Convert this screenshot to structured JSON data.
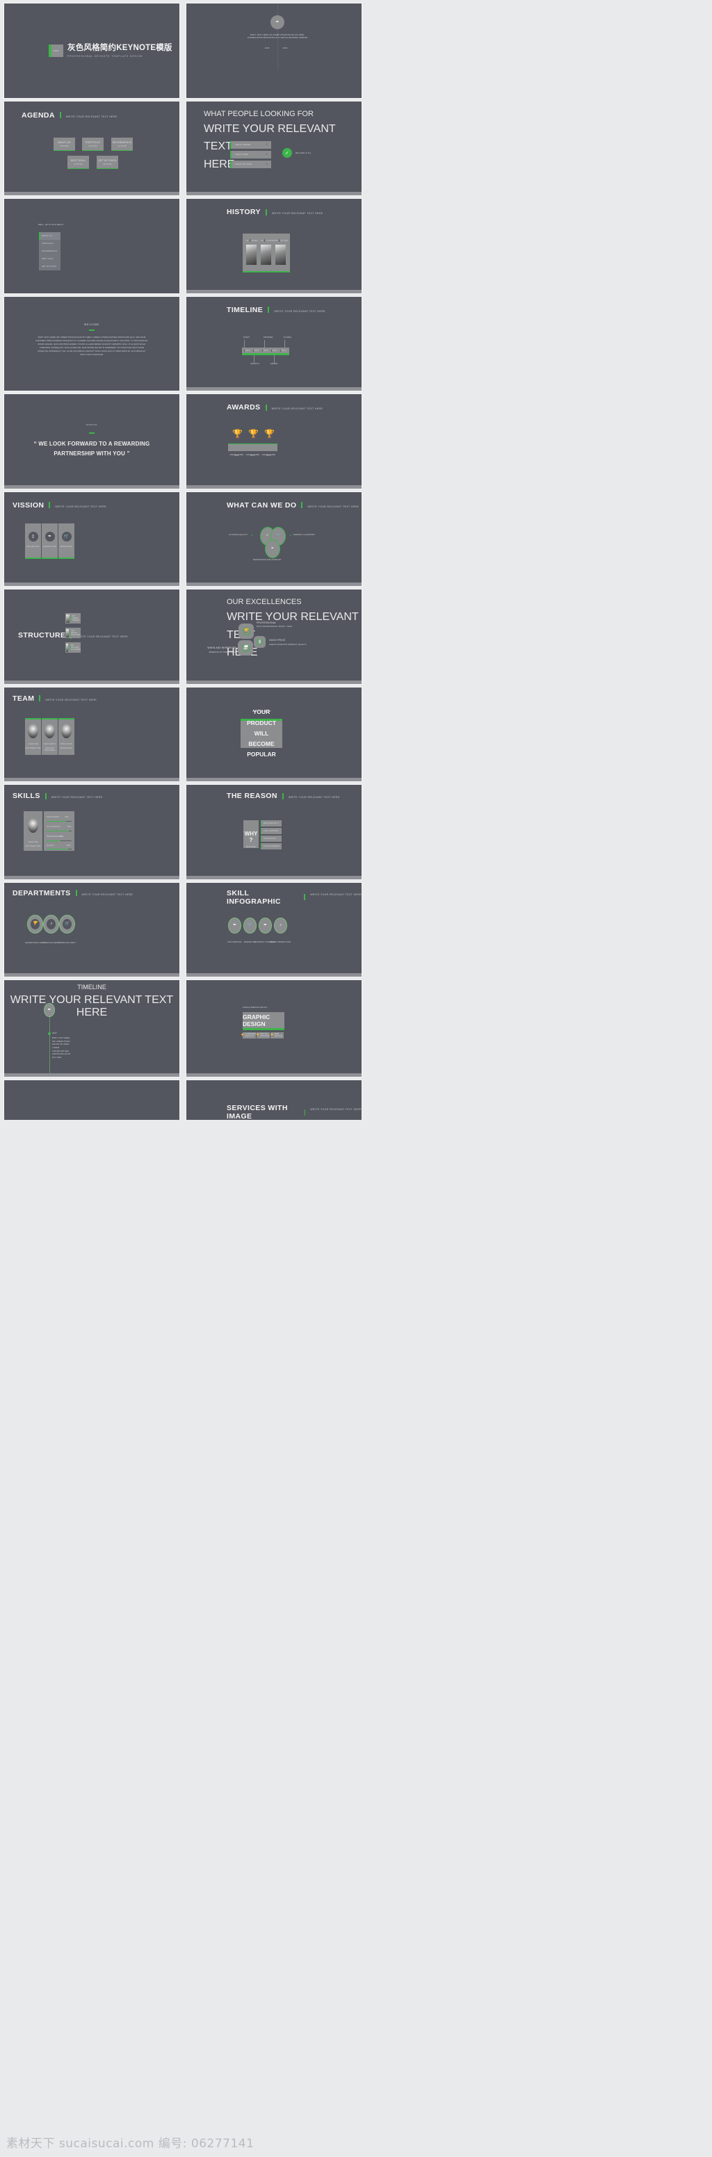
{
  "theme": {
    "bg": "#53565e",
    "accent": "#3cb54a",
    "panel": "#8b8d8f",
    "text": "#f1f2f3"
  },
  "watermark": "素材天下 sucaisucai.com 编号: 06277141",
  "common": {
    "subtitle": "WRITE YOUR RELEVANT TEXT HERE",
    "subtitle_l1": "WRITE YOUR RELEVANT TEXT",
    "subtitle_l2": "HERE"
  },
  "slides": [
    {
      "index": 1,
      "name": "cover",
      "logo_text": "LOGO",
      "title": "灰色风格简约KEYNOTE模版",
      "subtitle": "PROFESSIONAL KEYNOTE TEMPLATE DESIGN"
    },
    {
      "index": 2,
      "name": "intro",
      "icon": "feather-icon",
      "body": "BODY TEXT HERE OR LOREM IPSUM DOLOR SIT AMET CONSECTETUR ADIPISCING ELIT SED DO EIUSMOD TEMPOR",
      "label_left": "2015",
      "label_right": "2016"
    },
    {
      "index": 3,
      "name": "agenda",
      "title": "AGENDA",
      "subtitle": "WRITE YOUR RELEVANT TEXT HERE",
      "cards": [
        {
          "label": "ABOUT US",
          "time": "09:00 AM"
        },
        {
          "label": "PORTFOLIO",
          "time": "10:30 AM"
        },
        {
          "label": "INFOGRAPHICS",
          "time": "11:30 AM"
        },
        {
          "label": "NEXT GOAL",
          "time": "13:00 AM"
        },
        {
          "label": "GET IN TOUCH",
          "time": "14:00 AM"
        }
      ]
    },
    {
      "index": 4,
      "name": "what-people-looking-for",
      "title": "WHAT PEOPLE LOOKING FOR",
      "rows": [
        "GREAT THEMES",
        "GREAT NAME",
        "GREAT VISITORS"
      ],
      "badge_icon": "check-icon",
      "badge_label": "WE HAVE IT ALL"
    },
    {
      "index": 5,
      "name": "agenda-menu",
      "kicker": "WELL, LET'S TALK ABOUT",
      "items": [
        "ABOUT US",
        "PORTFOLIO",
        "INFOGRAPHICS",
        "NEXT GOAL",
        "GET IN TOUCH"
      ],
      "active": 0
    },
    {
      "index": 6,
      "name": "history",
      "title": "HISTORY",
      "subtitle": "WRITE YOUR RELEVANT TEXT HERE",
      "entries": [
        {
          "num": "01",
          "label": "START"
        },
        {
          "num": "02",
          "label": "CONCEPT"
        },
        {
          "num": "03",
          "label": "FLYING"
        }
      ]
    },
    {
      "index": 7,
      "name": "welcome",
      "kicker": "WELCOME",
      "body": "BODY TEXT HERE OR LOREM IPSUM DOLOR SIT AMET, LOREM CONSECTETUER ADIPISCING ELIT, SED DIAM NONUMMY NIBH EUISMOD TINCIDUNT UT LAOREET DOLORE MAGNA ALIQUAM ERAT VOLUTPAT. UT WISI ENIM AD MINIM VENIAM, QUIS NOSTRUD EXERCI TATION ULLAMCORPER SUSCIPIT LOBORTIS NISL UT ALIQUIP EX EA COMMODO CONSEQUAT. DUIS AUTEM VEL EUM IRIURE DOLOR IN HENDRERIT IN VULPUTATE VELIT ESSE MOLESTIE CONSEQUAT, VEL ILLUM DOLORE EU FEUGIAT NULLA FACILISIS AT VERO EROS ET ACCUMSAN ET IUSTO ODIO DIGNISSIM."
    },
    {
      "index": 8,
      "name": "timeline-horizontal",
      "title": "TIMELINE",
      "subtitle": "WRITE YOUR RELEVANT TEXT HERE",
      "top_labels": [
        "START",
        "PARTNER",
        "GLOBAL"
      ],
      "bottom_labels": [
        "GROWTH",
        "AWARD"
      ],
      "years": [
        "2010",
        "2011",
        "2012",
        "2013",
        "2014"
      ]
    },
    {
      "index": 9,
      "name": "mission-quote",
      "kicker": "MISSION",
      "quote_line1": "“ WE LOOK FORWARD TO A REWARDING",
      "quote_line2": "PARTNERSHIP WITH YOU ”"
    },
    {
      "index": 10,
      "name": "awards",
      "title": "AWARDS",
      "subtitle": "WRITE YOUR RELEVANT TEXT HERE",
      "items": [
        {
          "year": "2011",
          "label": "AWARD NAME"
        },
        {
          "year": "2012",
          "label": "AWARD NAME"
        },
        {
          "year": "2013",
          "label": "AWARD NAME"
        }
      ]
    },
    {
      "index": 11,
      "name": "vission",
      "title": "VISSION",
      "subtitle": "WRITE YOUR RELEVANT TEXT HERE",
      "cards": [
        {
          "label": "PROJECTING",
          "icon": "tablet-icon"
        },
        {
          "label": "PRODUCTION",
          "icon": "feather-icon"
        },
        {
          "label": "MARKETING",
          "icon": "cart-icon"
        }
      ]
    },
    {
      "index": 12,
      "name": "what-can-we-do",
      "title": "WHAT CAN WE DO",
      "subtitle": "WRITE YOUR RELEVANT TEXT HERE",
      "labels": [
        "ULTIMATE QUALITY",
        "PERFECT & SUPPORT",
        "RESPONSIVE AND SUPPORT"
      ],
      "icons": [
        "search-icon",
        "cart-icon",
        "feather-icon"
      ]
    },
    {
      "index": 13,
      "name": "structure",
      "title": "STRUCTURE",
      "subtitle": "WRITE YOUR RELEVANT TEXT HERE",
      "people": [
        {
          "name": "MR. JAMES",
          "role": "OWNER"
        },
        {
          "name": "MR. BRIAN",
          "role": "PARTNER"
        },
        {
          "name": "MR. SALAMA",
          "role": "FOUNDER"
        }
      ]
    },
    {
      "index": 14,
      "name": "our-excellences",
      "title": "OUR EXCELLENCES",
      "subtitle_l1": "WRITE YOUR RELEVANT TEXT",
      "subtitle_l2": "HERE",
      "items": [
        {
          "label": "PROFESSIONAL",
          "desc": "WITH PROFESSIONAL WORK / YEAR",
          "icon": "trophy-icon"
        },
        {
          "label": "GOOD PRICE",
          "desc": "CHEAP PRICE BUT PERFECT QUALITY",
          "icon": "dollar-icon"
        },
        {
          "label": "WHEN AND WHEREVER",
          "desc": "FREEDOM OF TIME / PLACE",
          "icon": "laptop-icon"
        }
      ]
    },
    {
      "index": 15,
      "name": "team",
      "title": "TEAM",
      "subtitle": "WRITE YOUR RELEVANT TEXT HERE",
      "members": [
        {
          "name": "JOHN DOE",
          "role": "ART DIRECTOR"
        },
        {
          "name": "SARA SMITH",
          "role": "GRAPHIC DESIGNER"
        },
        {
          "name": "SMILE RYAN",
          "role": "MARKETING"
        }
      ]
    },
    {
      "index": 16,
      "name": "product-result",
      "kicker": "WHAT THE RESULT",
      "line1": "YOUR PRODUCT WILL",
      "line2": "BECOME POPULAR"
    },
    {
      "index": 17,
      "name": "skills",
      "title": "SKILLS",
      "subtitle": "WRITE YOUR RELEVANT TEXT HERE",
      "person": {
        "name": "JOHN DOE",
        "role": "ART DIRECTOR"
      },
      "bars": [
        {
          "label": "PHOTOSHOP",
          "value": "78%",
          "pct": 78
        },
        {
          "label": "ILLUSTRATOR",
          "value": "90%",
          "pct": 90
        },
        {
          "label": "DREAMWEAVER",
          "value": "55%",
          "pct": 55
        },
        {
          "label": "3D MAX",
          "value": "85%",
          "pct": 85
        }
      ]
    },
    {
      "index": 18,
      "name": "the-reason",
      "title": "THE REASON",
      "subtitle": "WRITE YOUR RELEVANT TEXT HERE",
      "why": "WHY ?",
      "why_sub": "BECAUSE",
      "reasons": [
        "RESPONSIVE IT",
        "FULL SUPPORT",
        "GUARANTEE",
        "CLEAN MODERN"
      ]
    },
    {
      "index": 19,
      "name": "departments",
      "title": "DEPARTMENTS",
      "subtitle": "WRITE YOUR RELEVANT TEXT HERE",
      "items": [
        {
          "label": "ADVERTISING DEPT.",
          "icon": "trophy-icon"
        },
        {
          "label": "CREATIVE DEPT.",
          "icon": "search-icon"
        },
        {
          "label": "MARKETING DEPT.",
          "icon": "cart-icon"
        }
      ]
    },
    {
      "index": 20,
      "name": "skill-infographic",
      "title": "SKILL INFOGRAPHIC",
      "subtitle": "WRITE YOUR RELEVANT TEXT HERE",
      "items": [
        {
          "label": "COPYWRITING",
          "icon": "feather-icon"
        },
        {
          "label": "MARKETING",
          "icon": "cart-icon"
        },
        {
          "label": "CONTENT STRATEGY",
          "icon": "quill-icon"
        },
        {
          "label": "MUSIC PRODUCTION",
          "icon": "music-note-icon"
        }
      ]
    },
    {
      "index": 21,
      "name": "timeline-vertical",
      "title": "TIMELINE",
      "subtitle": "WRITE YOUR RELEVANT TEXT HERE",
      "icon": "feather-icon",
      "year": "2009",
      "body": "BODY TEXT HERE OR LOREM IPSUM DOLOR SIT AMET LOREM CONSECTETUER ADIPISCING ELITH ELIT SED"
    },
    {
      "index": 22,
      "name": "single-service",
      "kicker": "SINGLE SERVICE DETAIL",
      "headline": "GRAPHIC DESIGN",
      "buttons": [
        {
          "label": "CORPORATE IDENTITY",
          "icon": "trophy-icon"
        },
        {
          "label": "DIGITAL PRINTING",
          "icon": "trophy-icon"
        },
        {
          "label": "WEB DESIGN",
          "icon": "trophy-icon"
        }
      ]
    },
    {
      "index": 23,
      "name": "services-with-image",
      "title": "SERVICES WITH IMAGE",
      "subtitle": "WRITE YOUR RELEVANT TEXT HERE"
    }
  ]
}
